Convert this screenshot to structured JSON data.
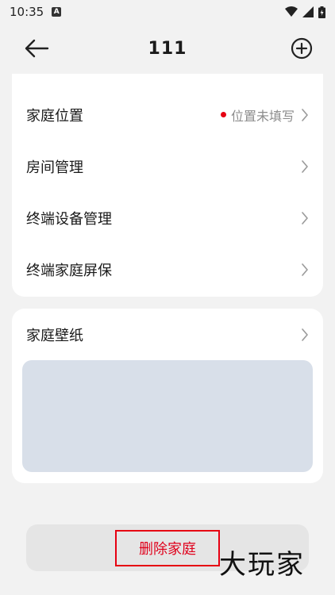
{
  "status_bar": {
    "time": "10:35",
    "notif_icon": "a-icon"
  },
  "header": {
    "title": "111",
    "back_icon": "arrow-left-icon",
    "add_icon": "plus-circle-icon"
  },
  "settings": [
    {
      "label": "家庭位置",
      "value": "位置未填写",
      "has_dot": true
    },
    {
      "label": "房间管理"
    },
    {
      "label": "终端设备管理"
    },
    {
      "label": "终端家庭屏保"
    }
  ],
  "wallpaper": {
    "label": "家庭壁纸"
  },
  "actions": {
    "delete_label": "删除家庭"
  },
  "watermark": "大玩家",
  "colors": {
    "accent_red": "#e60012",
    "preview_bg": "#d8dfe9",
    "page_bg": "#f2f2f2"
  }
}
